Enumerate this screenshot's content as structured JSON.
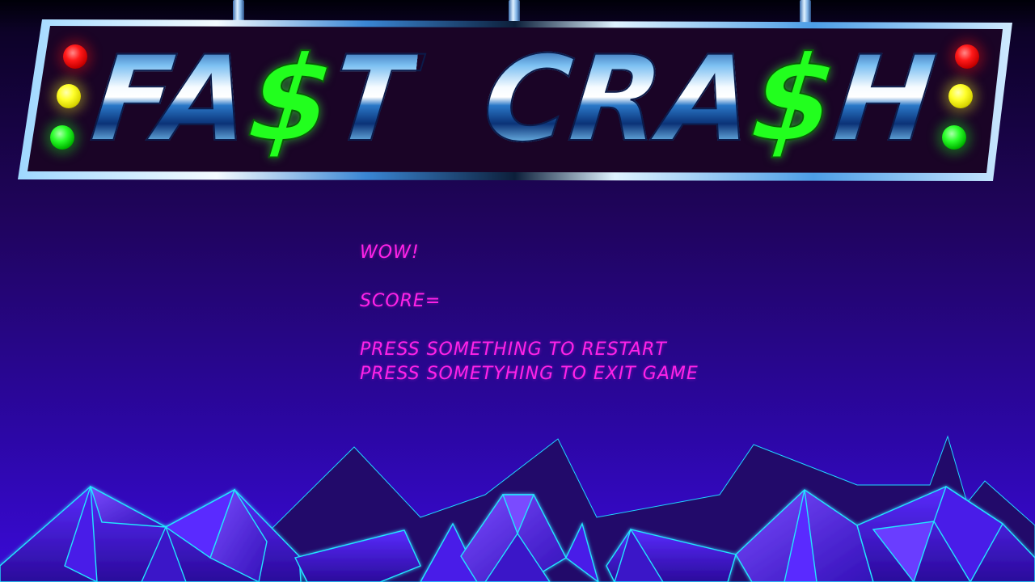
{
  "title": {
    "parts": [
      "FA",
      "$",
      "T",
      "CRA",
      "$",
      "H"
    ]
  },
  "message": {
    "exclamation": "WOW!",
    "score_label": "SCORE=",
    "score_value": "",
    "restart_hint": "PRESS SOMETHING TO RESTART",
    "exit_hint": "PRESS SOMETYHING TO EXIT GAME"
  },
  "lights": {
    "left": [
      "red",
      "yellow",
      "green"
    ],
    "right": [
      "red",
      "yellow",
      "green"
    ]
  },
  "colors": {
    "message_text": "#ff22e8",
    "dollar": "#22ff1e",
    "background_top": "#0d0228",
    "background_bottom": "#3a0ad8",
    "mountain_edge": "#22e6ff"
  }
}
